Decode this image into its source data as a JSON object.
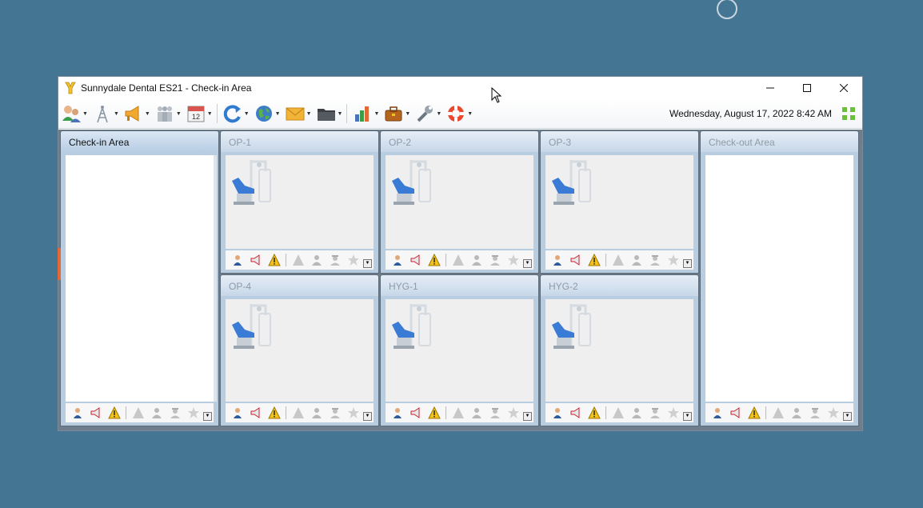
{
  "window": {
    "title": "Sunnydale Dental ES21 - Check-in Area",
    "controls": [
      "minimize-icon",
      "maximize-icon",
      "close-icon"
    ]
  },
  "toolbar": {
    "items": [
      {
        "icon": "patients-icon"
      },
      {
        "icon": "antenna-icon"
      },
      {
        "icon": "megaphone-icon"
      },
      {
        "icon": "people-icon"
      },
      {
        "icon": "calendar-icon",
        "badge": "12"
      },
      {
        "icon": "refresh-icon"
      },
      {
        "icon": "globe-icon"
      },
      {
        "icon": "mail-icon"
      },
      {
        "icon": "folder-icon"
      },
      {
        "icon": "chart-icon"
      },
      {
        "icon": "briefcase-icon"
      },
      {
        "icon": "wrench-icon"
      },
      {
        "icon": "lifebuoy-icon"
      }
    ],
    "datetime": "Wednesday, August 17, 2022 8:42 AM"
  },
  "panels": {
    "checkin": {
      "title": "Check-in Area"
    },
    "op1": {
      "title": "OP-1"
    },
    "op2": {
      "title": "OP-2"
    },
    "op3": {
      "title": "OP-3"
    },
    "op4": {
      "title": "OP-4"
    },
    "hyg1": {
      "title": "HYG-1"
    },
    "hyg2": {
      "title": "HYG-2"
    },
    "checkout": {
      "title": "Check-out Area"
    }
  },
  "footer_icons": [
    "person-icon",
    "megaphone-icon",
    "warning-icon",
    "alert-grey-icon",
    "user-grey-icon",
    "user-hat-icon",
    "star-icon"
  ],
  "colors": {
    "desktop": "#447593",
    "accent": "#3a7bd5",
    "warning": "#f2c21b"
  }
}
